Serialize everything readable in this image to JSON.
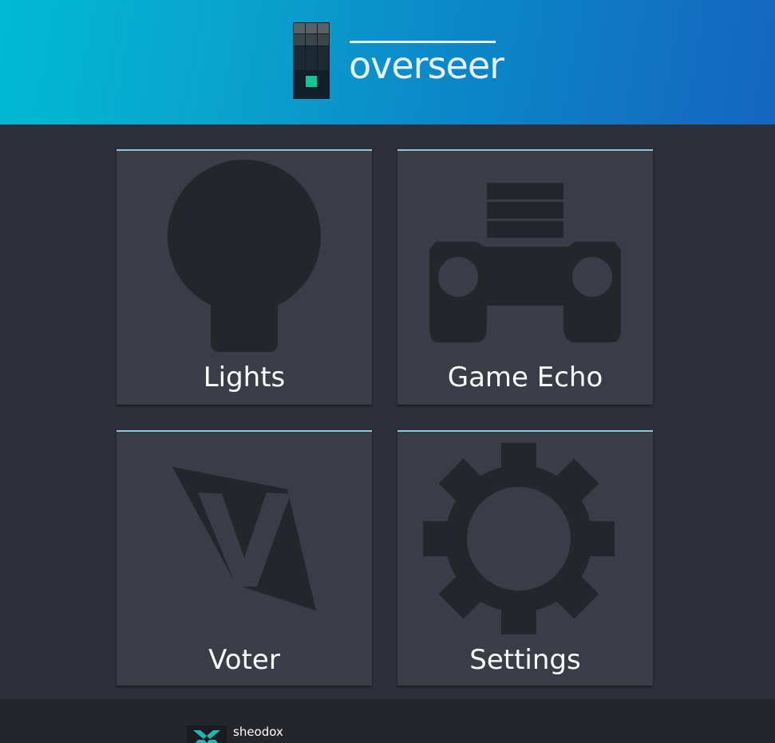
{
  "header": {
    "app_title": "overseer",
    "logo_icon": "overseer-logo-icon",
    "gradient": [
      "#00bad4",
      "#1565c0"
    ]
  },
  "tiles": [
    {
      "label": "Lights",
      "icon": "lightbulb-icon"
    },
    {
      "label": "Game Echo",
      "icon": "gamepad-icon"
    },
    {
      "label": "Voter",
      "icon": "voter-logo-icon"
    },
    {
      "label": "Settings",
      "icon": "gear-icon"
    }
  ],
  "footer": {
    "brand": "sheodox",
    "logo_icon": "sheodox-logo-icon",
    "accent": "#1fb8b0"
  },
  "colors": {
    "background": "#2e2f38",
    "tile": "#3a3c47",
    "tile_accent": "#8fc7dd",
    "icon": "#25262c",
    "footer": "#25262c"
  }
}
